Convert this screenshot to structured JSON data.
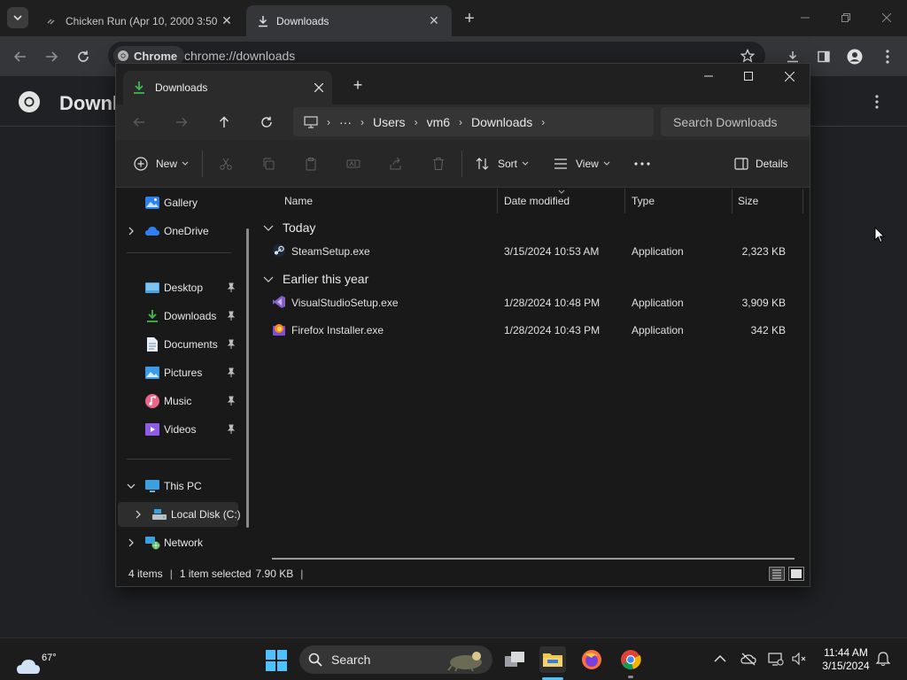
{
  "chrome": {
    "tabs": [
      {
        "title": "Chicken Run (Apr 10, 2000 3:50"
      },
      {
        "title": "Downloads"
      }
    ],
    "scheme_chip": "Chrome",
    "url": "chrome://downloads",
    "page_title": "Downloads"
  },
  "explorer": {
    "tab_title": "Downloads",
    "breadcrumb": [
      "Users",
      "vm6",
      "Downloads"
    ],
    "search_placeholder": "Search Downloads",
    "toolbar": {
      "new_label": "New",
      "sort_label": "Sort",
      "view_label": "View",
      "details_label": "Details"
    },
    "nav": {
      "gallery": "Gallery",
      "onedrive": "OneDrive",
      "desktop": "Desktop",
      "downloads": "Downloads",
      "documents": "Documents",
      "pictures": "Pictures",
      "music": "Music",
      "videos": "Videos",
      "this_pc": "This PC",
      "local_disk": "Local Disk (C:)",
      "network": "Network"
    },
    "columns": {
      "name": "Name",
      "date": "Date modified",
      "type": "Type",
      "size": "Size"
    },
    "groups": [
      {
        "label": "Today",
        "files": [
          {
            "name": "SteamSetup.exe",
            "date": "3/15/2024 10:53 AM",
            "type": "Application",
            "size": "2,323 KB",
            "icon": "steam-icon"
          }
        ]
      },
      {
        "label": "Earlier this year",
        "files": [
          {
            "name": "VisualStudioSetup.exe",
            "date": "1/28/2024 10:48 PM",
            "type": "Application",
            "size": "3,909 KB",
            "icon": "visual-studio-icon"
          },
          {
            "name": "Firefox Installer.exe",
            "date": "1/28/2024 10:43 PM",
            "type": "Application",
            "size": "342 KB",
            "icon": "firefox-icon"
          }
        ]
      }
    ],
    "status": {
      "item_count": "4 items",
      "selection": "1 item selected",
      "size": "7.90 KB"
    }
  },
  "taskbar": {
    "temperature": "67°",
    "search_label": "Search",
    "time": "11:44 AM",
    "date": "3/15/2024"
  },
  "colors": {
    "accent": "#4cc2ff",
    "downloads_green": "#3fb950",
    "folder_yellow": "#f2c94c"
  }
}
